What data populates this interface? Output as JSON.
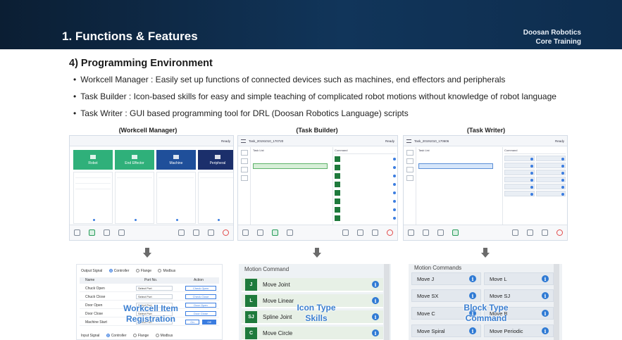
{
  "header": {
    "title": "1. Functions & Features",
    "brand_line1": "Doosan Robotics",
    "brand_line2": "Core Training"
  },
  "section_title": "4) Programming Environment",
  "bullets": [
    "Workcell Manager : Easily set up functions of connected devices such as machines, end effectors and peripherals",
    "Task Builder : Icon-based skills for easy and simple teaching of complicated robot motions without knowledge of robot language",
    "Task Writer : GUI based programming  tool for DRL (Doosan Robotics Language) scripts"
  ],
  "captions": {
    "workcell": "(Workcell Manager)",
    "builder": "(Task Builder)",
    "writer": "(Task Writer)"
  },
  "screens": {
    "workcell": {
      "ready": "Ready",
      "tiles": [
        {
          "label": "Robot",
          "color": "#2fb07a"
        },
        {
          "label": "End Effector",
          "color": "#2fb07a"
        },
        {
          "label": "Machine",
          "color": "#1f4f9a"
        },
        {
          "label": "Peripheral",
          "color": "#1b2f6b"
        }
      ]
    },
    "builder": {
      "title": "Task_20191010_170720",
      "ready": "Ready",
      "list_header": "Task List",
      "cmd_header": "Command"
    },
    "writer": {
      "title": "Task_20191010_170606",
      "ready": "Ready",
      "list_header": "Task List",
      "cmd_header": "Command"
    }
  },
  "workcell_registration": {
    "output_signal_label": "Output Signal",
    "radio_options": [
      "Controller",
      "Flange",
      "Modbus"
    ],
    "columns": [
      "Name",
      "Port No.",
      "Action"
    ],
    "rows": [
      {
        "name": "Chuck Open",
        "port": "Select Port",
        "action": "Check Open"
      },
      {
        "name": "Chuck Close",
        "port": "Select Port",
        "action": "Check Close"
      },
      {
        "name": "Door Open",
        "port": "Select Port",
        "action": "Door Open"
      },
      {
        "name": "Door Close",
        "port": "Select Port",
        "action": "Door Close"
      },
      {
        "name": "Machine Start",
        "port": "Select Port",
        "action": ""
      }
    ],
    "on_label": "On",
    "off_label": "Off",
    "input_signal_label": "Input Signal",
    "overlay": [
      "Workcell Item",
      "Registration"
    ]
  },
  "motion_command": {
    "title": "Motion Command",
    "items": [
      {
        "icon": "J",
        "label": "Move Joint"
      },
      {
        "icon": "L",
        "label": "Move Linear"
      },
      {
        "icon": "SJ",
        "label": "Spline Joint"
      },
      {
        "icon": "C",
        "label": "Move Circle"
      }
    ],
    "overlay": [
      "Icon Type",
      "Skills"
    ]
  },
  "block_command": {
    "title": "Motion Commands",
    "items": [
      "Move J",
      "Move L",
      "Move SX",
      "Move SJ",
      "Move C",
      "Move B",
      "Move Spiral",
      "Move Periodic"
    ],
    "overlay": [
      "Block Type",
      "Command"
    ]
  },
  "colors": {
    "banner": "#11355a",
    "accent_blue": "#3b7fd1",
    "icon_green": "#1f7a3c"
  }
}
